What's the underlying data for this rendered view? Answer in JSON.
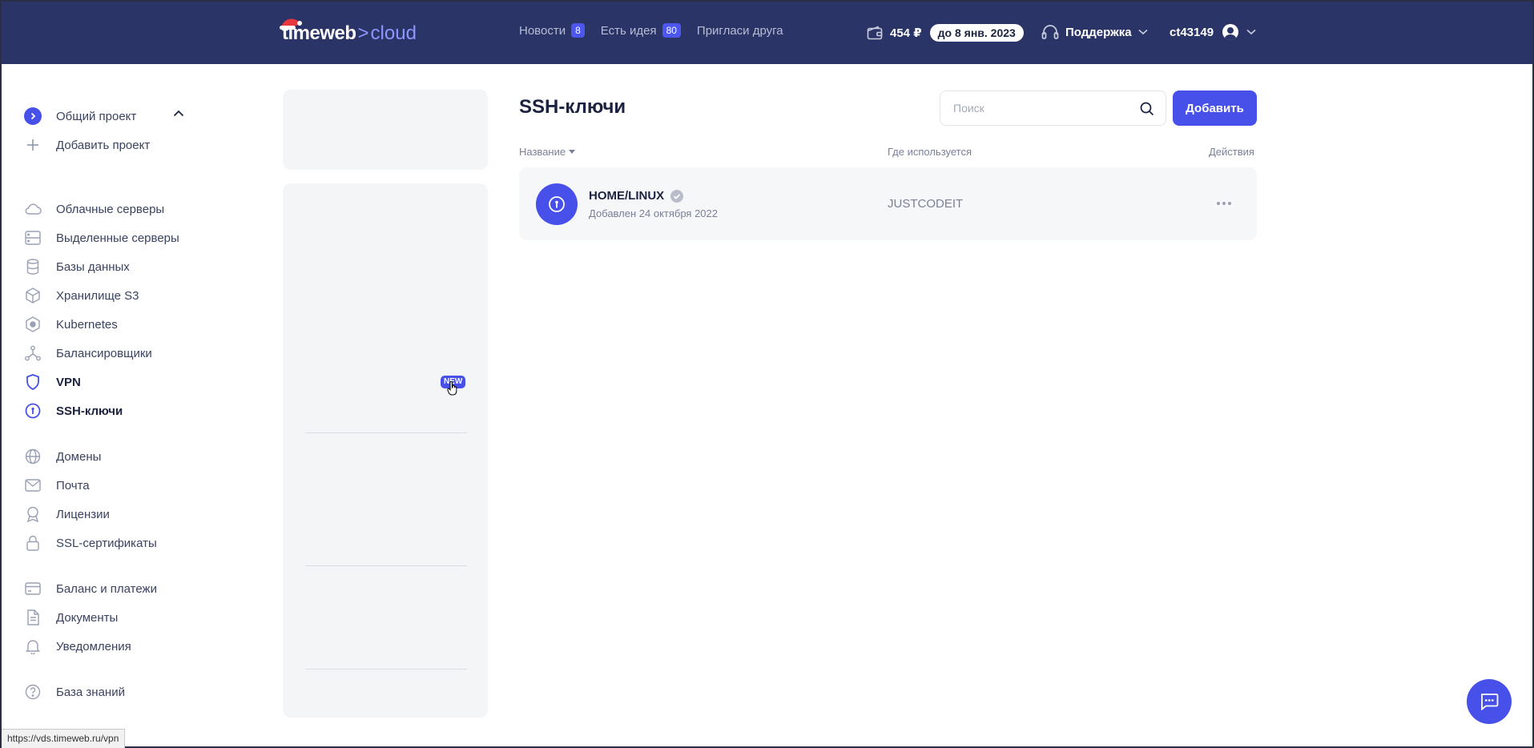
{
  "header": {
    "logo": {
      "word": "timeweb",
      "arrow": ">",
      "suffix": "cloud"
    },
    "nav": [
      {
        "label": "Новости",
        "badge": "8"
      },
      {
        "label": "Есть идея",
        "badge": "80"
      },
      {
        "label": "Пригласи друга",
        "badge": null
      }
    ],
    "balance": "454 ₽",
    "balance_until": "до 8 янв. 2023",
    "support_label": "Поддержка",
    "username": "ct43149"
  },
  "sidebar": {
    "project": {
      "label": "Общий проект",
      "add_label": "Добавить проект"
    },
    "groups": [
      [
        {
          "label": "Облачные серверы",
          "icon": "cloud-icon"
        },
        {
          "label": "Выделенные серверы",
          "icon": "server-icon"
        },
        {
          "label": "Базы данных",
          "icon": "database-icon"
        },
        {
          "label": "Хранилище S3",
          "icon": "cube-icon"
        },
        {
          "label": "Kubernetes",
          "icon": "kubernetes-icon"
        },
        {
          "label": "Балансировщики",
          "icon": "balancer-icon"
        },
        {
          "label": "VPN",
          "icon": "shield-icon",
          "badge": "NEW"
        },
        {
          "label": "SSH-ключи",
          "icon": "key-icon",
          "active": true
        }
      ],
      [
        {
          "label": "Домены",
          "icon": "globe-icon"
        },
        {
          "label": "Почта",
          "icon": "mail-icon"
        },
        {
          "label": "Лицензии",
          "icon": "award-icon"
        },
        {
          "label": "SSL-сертификаты",
          "icon": "lock-icon"
        }
      ],
      [
        {
          "label": "Баланс и платежи",
          "icon": "card-icon"
        },
        {
          "label": "Документы",
          "icon": "document-icon"
        },
        {
          "label": "Уведомления",
          "icon": "bell-icon"
        }
      ],
      [
        {
          "label": "База знаний",
          "icon": "help-icon"
        }
      ]
    ]
  },
  "main": {
    "title": "SSH-ключи",
    "search_placeholder": "Поиск",
    "add_label": "Добавить",
    "columns": {
      "name": "Название",
      "used": "Где используется",
      "actions": "Действия"
    },
    "keys": [
      {
        "name": "HOME/LINUX",
        "added": "Добавлен 24 октября 2022",
        "used_in": "JUSTCODEIT"
      }
    ]
  },
  "status_url": "https://vds.timeweb.ru/vpn",
  "colors": {
    "header_bg": "#2b3466",
    "accent": "#4750e8",
    "panel_bg": "#f4f5f7"
  }
}
